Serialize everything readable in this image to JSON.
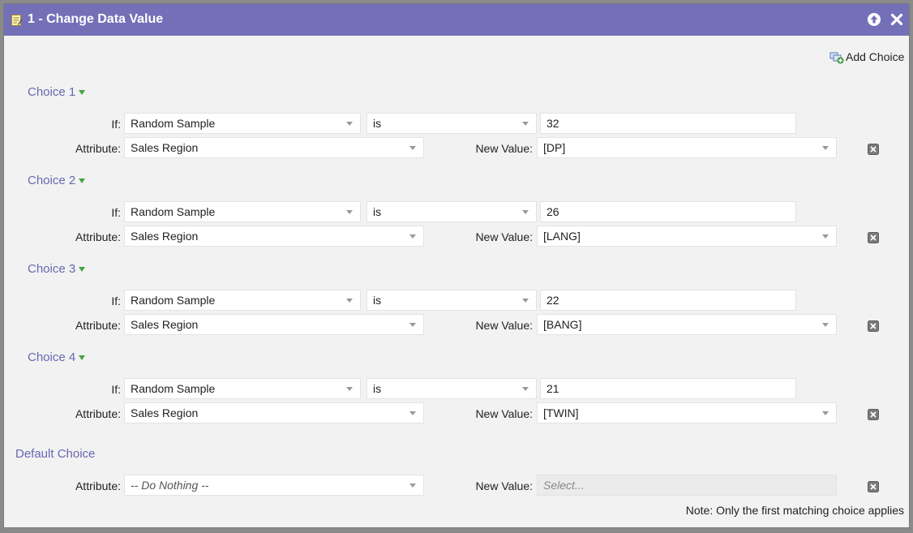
{
  "window": {
    "title": "1 - Change Data Value"
  },
  "toolbar": {
    "add_choice_label": "Add Choice"
  },
  "labels": {
    "if": "If:",
    "attribute": "Attribute:",
    "new_value": "New Value:"
  },
  "choices": [
    {
      "title": "Choice 1",
      "if_field": "Random Sample",
      "operator": "is",
      "value": "32",
      "attribute": "Sales Region",
      "new_value": "[DP]"
    },
    {
      "title": "Choice 2",
      "if_field": "Random Sample",
      "operator": "is",
      "value": "26",
      "attribute": "Sales Region",
      "new_value": "[LANG]"
    },
    {
      "title": "Choice 3",
      "if_field": "Random Sample",
      "operator": "is",
      "value": "22",
      "attribute": "Sales Region",
      "new_value": "[BANG]"
    },
    {
      "title": "Choice 4",
      "if_field": "Random Sample",
      "operator": "is",
      "value": "21",
      "attribute": "Sales Region",
      "new_value": "[TWIN]"
    }
  ],
  "default_choice": {
    "title": "Default Choice",
    "attribute": "-- Do Nothing --",
    "new_value_placeholder": "Select..."
  },
  "note": "Note: Only the first matching choice applies",
  "colors": {
    "titlebar": "#7470b8",
    "choice_title": "#6b66b0",
    "caret": "#4aa347"
  }
}
